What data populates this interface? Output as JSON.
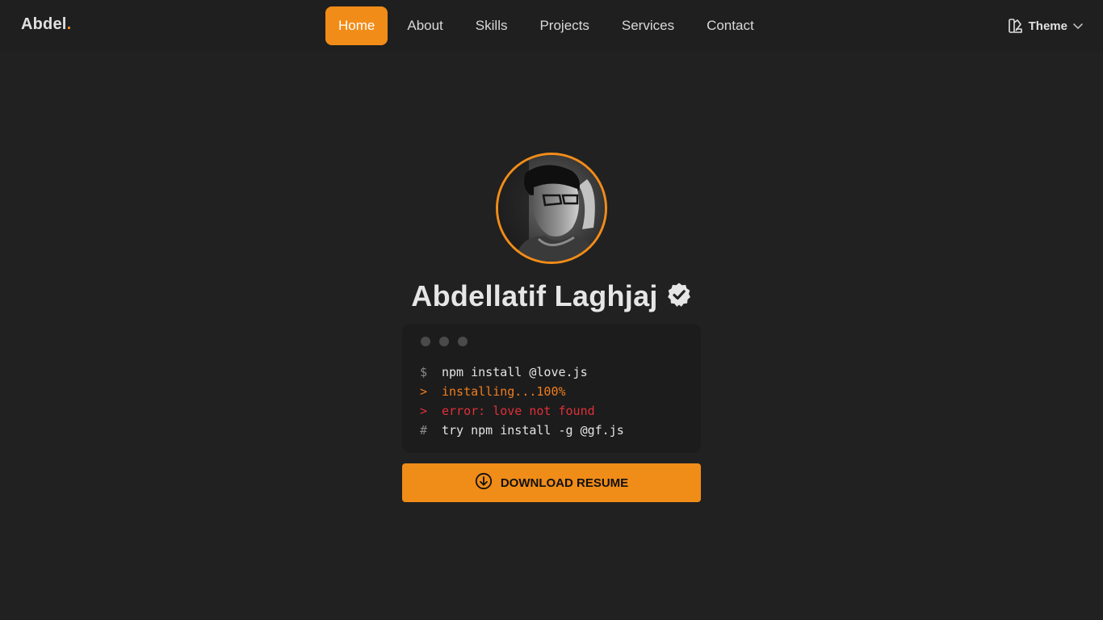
{
  "brand": {
    "name": "Abdel",
    "dot": "."
  },
  "nav": {
    "items": [
      {
        "label": "Home",
        "active": true
      },
      {
        "label": "About"
      },
      {
        "label": "Skills"
      },
      {
        "label": "Projects"
      },
      {
        "label": "Services"
      },
      {
        "label": "Contact"
      }
    ],
    "theme_label": "Theme"
  },
  "profile": {
    "name": "Abdellatif Laghjaj",
    "verified_icon": "verified-badge-icon",
    "avatar_icon": "profile-photo"
  },
  "terminal": {
    "lines": [
      {
        "prompt": "$",
        "text": "npm install @love.js",
        "kind": "command"
      },
      {
        "prompt": ">",
        "text": "installing...100%",
        "kind": "ok"
      },
      {
        "prompt": ">",
        "text": "error: love not found",
        "kind": "error"
      },
      {
        "prompt": "#",
        "text": "try npm install -g @gf.js",
        "kind": "comment"
      }
    ]
  },
  "download": {
    "label": "DOWNLOAD RESUME",
    "icon": "download-circle-icon"
  },
  "colors": {
    "accent": "#f28c18",
    "background": "#212121",
    "terminal_bg": "#1c1c1c",
    "error": "#e0303a",
    "success": "#f07e1f"
  }
}
